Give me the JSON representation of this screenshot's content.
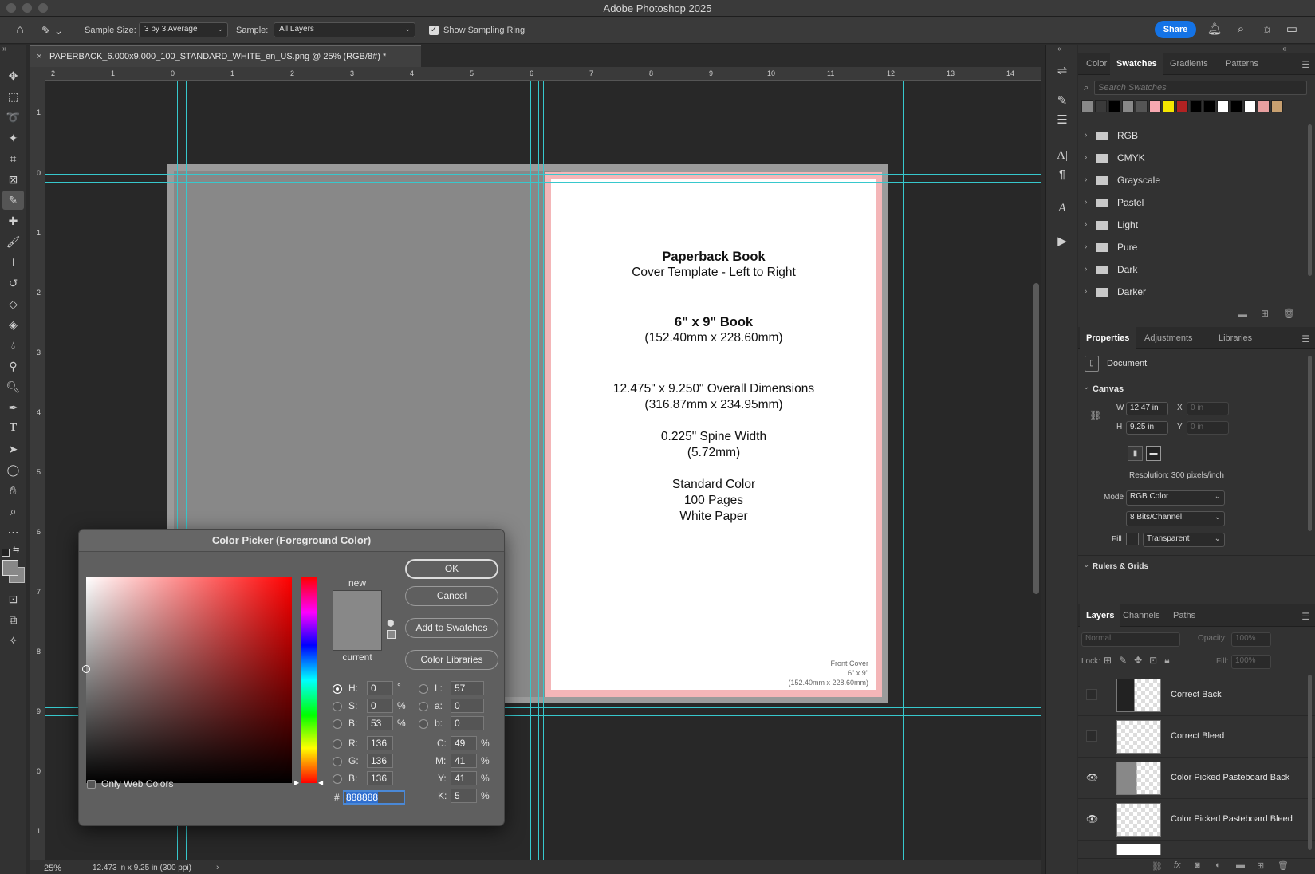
{
  "app": {
    "title": "Adobe Photoshop 2025"
  },
  "options_bar": {
    "sample_size_label": "Sample Size:",
    "sample_size_value": "3 by 3 Average",
    "sample_label": "Sample:",
    "sample_value": "All Layers",
    "show_ring_label": "Show Sampling Ring",
    "share_label": "Share"
  },
  "document": {
    "tab_title": "PAPERBACK_6.000x9.000_100_STANDARD_WHITE_en_US.png @ 25% (RGB/8#) *",
    "zoom": "25%",
    "status": "12.473 in x 9.25 in (300 ppi)"
  },
  "rulers": {
    "h_ticks": [
      "2",
      "1",
      "0",
      "1",
      "2",
      "3",
      "4",
      "5",
      "6",
      "7",
      "8",
      "9",
      "10",
      "11",
      "12",
      "13",
      "14"
    ],
    "v_ticks": [
      "1",
      "0",
      "1",
      "2",
      "3",
      "4",
      "5",
      "6",
      "7",
      "8",
      "9",
      "0",
      "1"
    ]
  },
  "page": {
    "line1": "Paperback Book",
    "line2": "Cover Template - Left to Right",
    "line3": "6\" x 9\" Book",
    "line4": "(152.40mm x 228.60mm)",
    "line5": "12.475\" x 9.250\" Overall Dimensions",
    "line6": "(316.87mm x 234.95mm)",
    "line7": "0.225\" Spine Width",
    "line8": "(5.72mm)",
    "line9": "Standard Color",
    "line10": "100 Pages",
    "line11": "White Paper",
    "corner1": "Front Cover",
    "corner2": "6\" x 9\"",
    "corner3": "(152.40mm x 228.60mm)"
  },
  "swatches_panel": {
    "tabs": [
      "Color",
      "Swatches",
      "Gradients",
      "Patterns"
    ],
    "search_placeholder": "Search Swatches",
    "recent_colors": [
      "#888888",
      "#3a3a3a",
      "#000000",
      "#888888",
      "#555555",
      "#f7a8b0",
      "#f5e600",
      "#b22222",
      "#000000",
      "#000000",
      "#ffffff",
      "#000000",
      "#ffffff",
      "#e8a0a0",
      "#c8a070"
    ],
    "groups": [
      "RGB",
      "CMYK",
      "Grayscale",
      "Pastel",
      "Light",
      "Pure",
      "Dark",
      "Darker"
    ]
  },
  "properties_panel": {
    "tabs": [
      "Properties",
      "Adjustments",
      "Libraries"
    ],
    "doc_label": "Document",
    "canvas_label": "Canvas",
    "w_label": "W",
    "w_value": "12.47 in",
    "h_label": "H",
    "h_value": "9.25 in",
    "x_label": "X",
    "x_placeholder": "0 in",
    "y_label": "Y",
    "y_placeholder": "0 in",
    "resolution": "Resolution: 300 pixels/inch",
    "mode_label": "Mode",
    "mode_value": "RGB Color",
    "bits_value": "8 Bits/Channel",
    "fill_label": "Fill",
    "fill_value": "Transparent",
    "rulers_label": "Rulers & Grids"
  },
  "layers_panel": {
    "tabs": [
      "Layers",
      "Channels",
      "Paths"
    ],
    "blend_mode": "Normal",
    "opacity_label": "Opacity:",
    "opacity_value": "100%",
    "lock_label": "Lock:",
    "fill_label": "Fill:",
    "fill_value": "100%",
    "layers": [
      {
        "name": "Correct Back",
        "visible": false
      },
      {
        "name": "Correct Bleed",
        "visible": false
      },
      {
        "name": "Color Picked Pasteboard Back",
        "visible": true
      },
      {
        "name": "Color Picked Pasteboard Bleed",
        "visible": true
      }
    ]
  },
  "color_picker": {
    "title": "Color Picker (Foreground Color)",
    "new_label": "new",
    "current_label": "current",
    "ok": "OK",
    "cancel": "Cancel",
    "add_swatches": "Add to Swatches",
    "color_libraries": "Color Libraries",
    "only_web": "Only Web Colors",
    "h_label": "H:",
    "h_value": "0",
    "h_unit": "°",
    "s_label": "S:",
    "s_value": "0",
    "s_unit": "%",
    "b_label": "B:",
    "b_value": "53",
    "b_unit": "%",
    "r_label": "R:",
    "r_value": "136",
    "g_label": "G:",
    "g_value": "136",
    "bb_label": "B:",
    "bb_value": "136",
    "l_label": "L:",
    "l_value": "57",
    "a_label": "a:",
    "a_value": "0",
    "lb_label": "b:",
    "lb_value": "0",
    "c_label": "C:",
    "c_value": "49",
    "m_label": "M:",
    "m_value": "41",
    "y_label": "Y:",
    "y_value": "41",
    "k_label": "K:",
    "k_value": "5",
    "pct": "%",
    "hash": "#",
    "hex": "888888",
    "new_color": "#888888",
    "current_color": "#888888"
  }
}
